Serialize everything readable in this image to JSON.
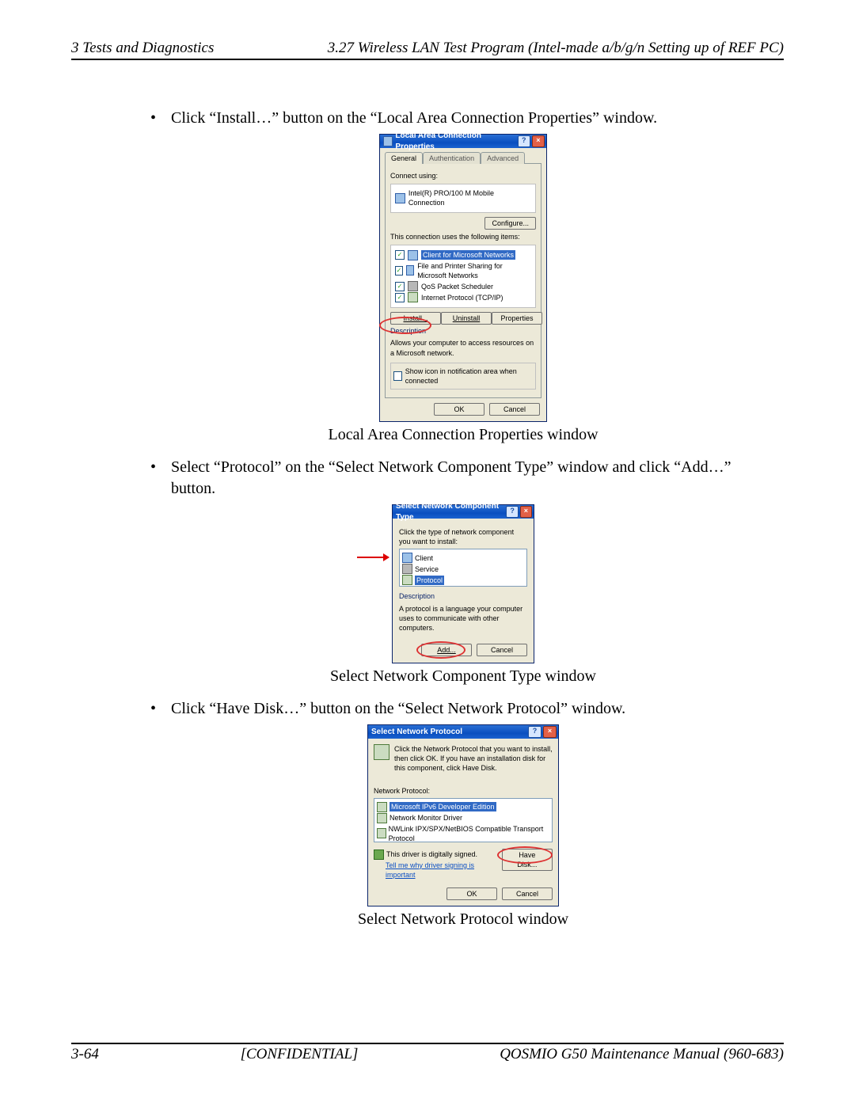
{
  "header": {
    "left": "3 Tests and Diagnostics",
    "right": "3.27 Wireless LAN Test Program (Intel-made a/b/g/n Setting up of REF PC)"
  },
  "footer": {
    "left": "3-64",
    "center": "[CONFIDENTIAL]",
    "right": "QOSMIO G50 Maintenance Manual (960-683)"
  },
  "step1": {
    "bullet": "Click “Install…” button on the “Local Area Connection Properties” window.",
    "caption": "Local Area Connection Properties window",
    "dlg": {
      "title": "Local Area Connection Properties",
      "tabs": [
        "General",
        "Authentication",
        "Advanced"
      ],
      "connect_label": "Connect using:",
      "adapter": "Intel(R) PRO/100 M Mobile Connection",
      "configure": "Configure...",
      "uses_label": "This connection uses the following items:",
      "items": [
        "Client for Microsoft Networks",
        "File and Printer Sharing for Microsoft Networks",
        "QoS Packet Scheduler",
        "Internet Protocol (TCP/IP)"
      ],
      "install": "Install...",
      "uninstall": "Uninstall",
      "properties": "Properties",
      "desc_h": "Description",
      "desc": "Allows your computer to access resources on a Microsoft network.",
      "showicon": "Show icon in notification area when connected",
      "ok": "OK",
      "cancel": "Cancel"
    }
  },
  "step2": {
    "bullet": "Select “Protocol” on the “Select Network Component Type” window and click “Add…” button.",
    "caption": "Select Network Component Type window",
    "dlg": {
      "title": "Select Network Component Type",
      "prompt": "Click the type of network component you want to install:",
      "items": [
        "Client",
        "Service",
        "Protocol"
      ],
      "desc_h": "Description",
      "desc": "A protocol is a language your computer uses to communicate with other computers.",
      "add": "Add...",
      "cancel": "Cancel"
    }
  },
  "step3": {
    "bullet": "Click “Have Disk…” button on the “Select Network Protocol” window.",
    "caption": "Select Network Protocol window",
    "dlg": {
      "title": "Select Network Protocol",
      "prompt": "Click the Network Protocol that you want to install, then click OK. If you have an installation disk for this component, click Have Disk.",
      "list_h": "Network Protocol:",
      "items": [
        "Microsoft IPv6 Developer Edition",
        "Network Monitor Driver",
        "NWLink IPX/SPX/NetBIOS Compatible Transport Protocol"
      ],
      "signed": "This driver is digitally signed.",
      "why": "Tell me why driver signing is important",
      "havedisk": "Have Disk...",
      "ok": "OK",
      "cancel": "Cancel"
    }
  }
}
